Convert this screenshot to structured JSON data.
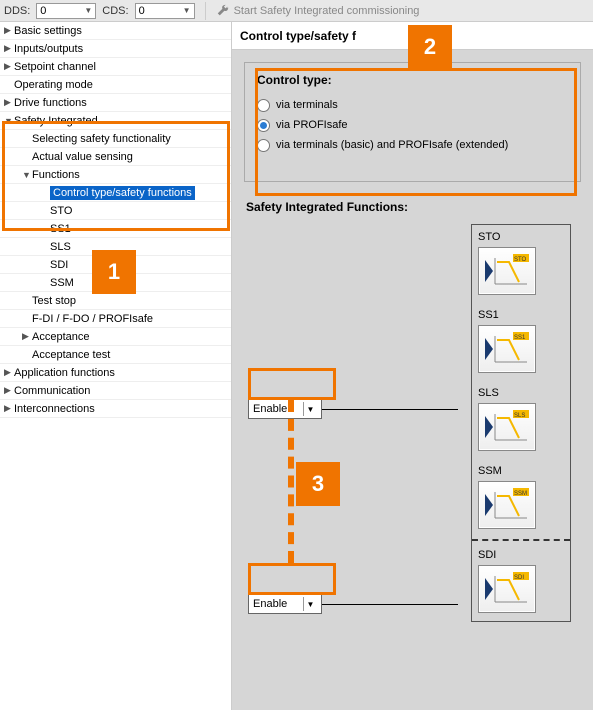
{
  "toolbar": {
    "dds_label": "DDS:",
    "dds_value": "0",
    "cds_label": "CDS:",
    "cds_value": "0",
    "start_btn": "Start Safety Integrated commissioning"
  },
  "tree": {
    "items": [
      {
        "label": "Basic settings",
        "caret": "▶",
        "depth": 0
      },
      {
        "label": "Inputs/outputs",
        "caret": "▶",
        "depth": 0
      },
      {
        "label": "Setpoint channel",
        "caret": "▶",
        "depth": 0
      },
      {
        "label": "Operating mode",
        "caret": "",
        "depth": 0
      },
      {
        "label": "Drive functions",
        "caret": "▶",
        "depth": 0
      },
      {
        "label": "Safety Integrated",
        "caret": "▼",
        "depth": 0
      },
      {
        "label": "Selecting safety functionality",
        "caret": "",
        "depth": 1
      },
      {
        "label": "Actual value sensing",
        "caret": "",
        "depth": 1
      },
      {
        "label": "Functions",
        "caret": "▼",
        "depth": 1
      },
      {
        "label": "Control type/safety functions",
        "caret": "",
        "depth": 2,
        "selected": true
      },
      {
        "label": "STO",
        "caret": "",
        "depth": 2
      },
      {
        "label": "SS1",
        "caret": "",
        "depth": 2
      },
      {
        "label": "SLS",
        "caret": "",
        "depth": 2
      },
      {
        "label": "SDI",
        "caret": "",
        "depth": 2
      },
      {
        "label": "SSM",
        "caret": "",
        "depth": 2
      },
      {
        "label": "Test stop",
        "caret": "",
        "depth": 1
      },
      {
        "label": "F-DI / F-DO / PROFIsafe",
        "caret": "",
        "depth": 1
      },
      {
        "label": "Acceptance",
        "caret": "▶",
        "depth": 1
      },
      {
        "label": "Acceptance test",
        "caret": "",
        "depth": 1
      },
      {
        "label": "Application functions",
        "caret": "▶",
        "depth": 0
      },
      {
        "label": "Communication",
        "caret": "▶",
        "depth": 0
      },
      {
        "label": "Interconnections",
        "caret": "▶",
        "depth": 0
      }
    ]
  },
  "content": {
    "title": "Control type/safety f",
    "control_type": {
      "heading": "Control type:",
      "options": [
        {
          "text": "via terminals",
          "checked": false
        },
        {
          "text": "via PROFIsafe",
          "checked": true
        },
        {
          "text": "via terminals (basic) and PROFIsafe (extended)",
          "checked": false
        }
      ]
    },
    "functions": {
      "heading": "Safety Integrated Functions:",
      "enable_label": "Enable",
      "list": [
        {
          "name": "STO"
        },
        {
          "name": "SS1"
        },
        {
          "name": "SLS"
        },
        {
          "name": "SSM"
        },
        {
          "name": "SDI"
        }
      ]
    }
  },
  "callouts": {
    "n1": "1",
    "n2": "2",
    "n3": "3"
  }
}
